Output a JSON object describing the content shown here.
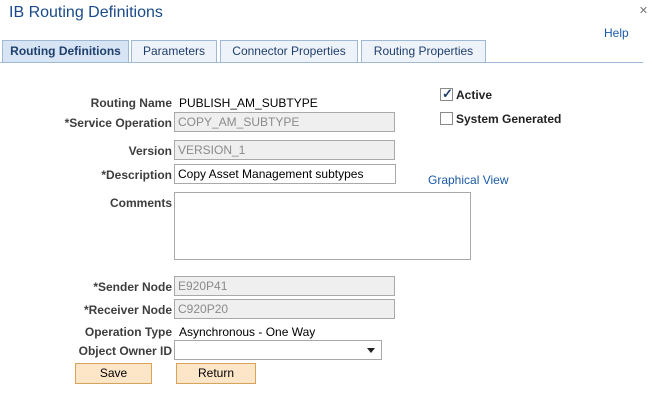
{
  "window": {
    "title": "IB Routing Definitions",
    "help_label": "Help"
  },
  "tabs": [
    {
      "label": "Routing Definitions",
      "active": true
    },
    {
      "label": "Parameters",
      "active": false
    },
    {
      "label": "Connector Properties",
      "active": false
    },
    {
      "label": "Routing Properties",
      "active": false
    }
  ],
  "form": {
    "routing_name_label": "Routing Name",
    "routing_name_value": "PUBLISH_AM_SUBTYPE",
    "service_operation_label": "*Service Operation",
    "service_operation_value": "COPY_AM_SUBTYPE",
    "version_label": "Version",
    "version_value": "VERSION_1",
    "description_label": "*Description",
    "description_value": "Copy Asset Management subtypes",
    "graphical_view_label": "Graphical View",
    "comments_label": "Comments",
    "comments_value": "",
    "sender_node_label": "*Sender Node",
    "sender_node_value": "E920P41",
    "receiver_node_label": "*Receiver Node",
    "receiver_node_value": "C920P20",
    "operation_type_label": "Operation Type",
    "operation_type_value": "Asynchronous - One Way",
    "object_owner_label": "Object Owner ID",
    "object_owner_value": ""
  },
  "checkboxes": {
    "active": {
      "label": "Active",
      "checked": true
    },
    "system_generated": {
      "label": "System Generated",
      "checked": false
    }
  },
  "buttons": {
    "save_label": "Save",
    "return_label": "Return"
  }
}
